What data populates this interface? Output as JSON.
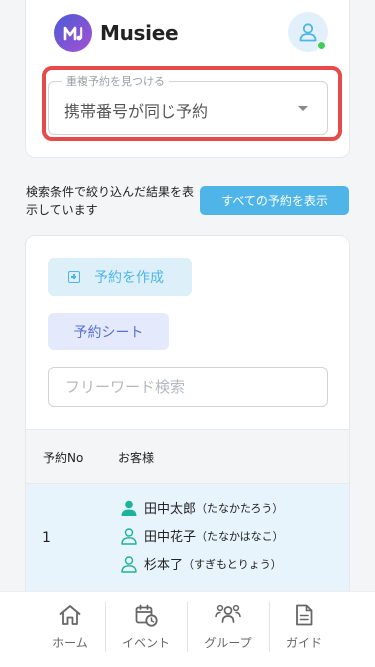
{
  "brand": {
    "name": "Musiee"
  },
  "duplicate_filter": {
    "legend": "重複予約を見つける",
    "value": "携帯番号が同じ予約"
  },
  "filter_notice": {
    "text": "検索条件で絞り込んだ結果を表示しています",
    "show_all_label": "すべての予約を表示"
  },
  "actions": {
    "create_label": "予約を作成",
    "sheet_label": "予約シート"
  },
  "search": {
    "placeholder": "フリーワード検索",
    "value": ""
  },
  "table": {
    "headers": [
      "予約No",
      "お客様"
    ],
    "rows": [
      {
        "no": "1",
        "customers": [
          {
            "name": "田中太郎",
            "kana": "（たなかたろう）",
            "primary": true
          },
          {
            "name": "田中花子",
            "kana": "（たなかはなこ）",
            "primary": false
          },
          {
            "name": "杉本了",
            "kana": "（すぎもとりょう）",
            "primary": false
          }
        ]
      }
    ]
  },
  "nav": {
    "items": [
      {
        "label": "ホーム",
        "icon": "home-icon"
      },
      {
        "label": "イベント",
        "icon": "calendar-clock-icon"
      },
      {
        "label": "グループ",
        "icon": "group-icon"
      },
      {
        "label": "ガイド",
        "icon": "document-icon"
      }
    ]
  },
  "colors": {
    "accent": "#4fb5e8",
    "highlight": "#e54b4b",
    "online": "#3ccf5a"
  }
}
